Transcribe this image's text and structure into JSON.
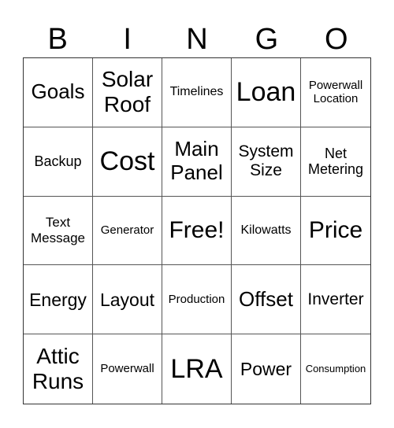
{
  "header": [
    "B",
    "I",
    "N",
    "G",
    "O"
  ],
  "cells": [
    {
      "text": "Goals",
      "size": "s26"
    },
    {
      "text": "Solar Roof",
      "size": "s28"
    },
    {
      "text": "Timelines",
      "size": "s16"
    },
    {
      "text": "Loan",
      "size": "s34"
    },
    {
      "text": "Powerwall Location",
      "size": "s15"
    },
    {
      "text": "Backup",
      "size": "s18"
    },
    {
      "text": "Cost",
      "size": "s34"
    },
    {
      "text": "Main Panel",
      "size": "s26"
    },
    {
      "text": "System Size",
      "size": "s21"
    },
    {
      "text": "Net Metering",
      "size": "s18"
    },
    {
      "text": "Text Message",
      "size": "s17"
    },
    {
      "text": "Generator",
      "size": "s15"
    },
    {
      "text": "Free!",
      "size": "s30"
    },
    {
      "text": "Kilowatts",
      "size": "s16"
    },
    {
      "text": "Price",
      "size": "s30"
    },
    {
      "text": "Energy",
      "size": "s23"
    },
    {
      "text": "Layout",
      "size": "s23"
    },
    {
      "text": "Production",
      "size": "s15"
    },
    {
      "text": "Offset",
      "size": "s26"
    },
    {
      "text": "Inverter",
      "size": "s21"
    },
    {
      "text": "Attic Runs",
      "size": "s28"
    },
    {
      "text": "Powerwall",
      "size": "s15"
    },
    {
      "text": "LRA",
      "size": "s34"
    },
    {
      "text": "Power",
      "size": "s23"
    },
    {
      "text": "Consumption",
      "size": "s13"
    }
  ]
}
